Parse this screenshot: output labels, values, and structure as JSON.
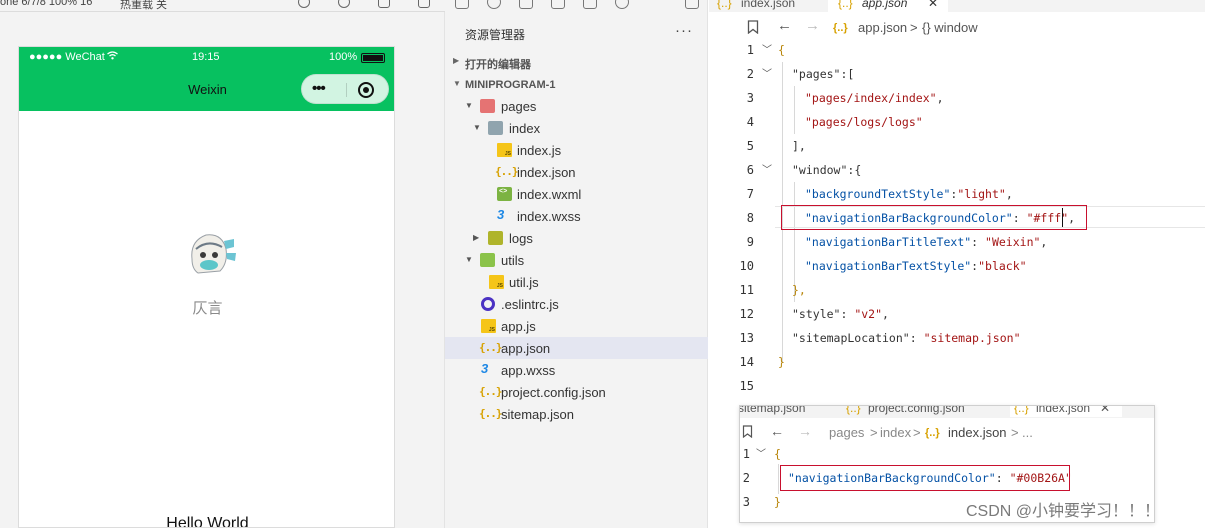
{
  "simulator": {
    "toolbar": {
      "device_text": "one 6/7/8 100% 16",
      "mode_text": "热重载 关"
    },
    "status_bar": {
      "signal": "●●●●● WeChat",
      "time": "19:15",
      "battery": "100%"
    },
    "nav_bar": {
      "title": "Weixin",
      "capsule_dots": "•••"
    },
    "user": {
      "nickname": "仄言"
    },
    "motto": "Hello World",
    "colors": {
      "nav_bg": "#07c160"
    }
  },
  "explorer": {
    "title": "资源管理器",
    "more": "···",
    "open_editors": "打开的编辑器",
    "project": "MINIPROGRAM-1",
    "files": [
      {
        "name": "pages",
        "icon": "folder-red"
      },
      {
        "name": "index",
        "icon": "folder-gray"
      },
      {
        "name": "index.js",
        "icon": "js"
      },
      {
        "name": "index.json",
        "icon": "json"
      },
      {
        "name": "index.wxml",
        "icon": "wxml"
      },
      {
        "name": "index.wxss",
        "icon": "wxss"
      },
      {
        "name": "logs",
        "icon": "folder-lime"
      },
      {
        "name": "utils",
        "icon": "folder-green"
      },
      {
        "name": "util.js",
        "icon": "js"
      },
      {
        "name": ".eslintrc.js",
        "icon": "eslint"
      },
      {
        "name": "app.js",
        "icon": "js"
      },
      {
        "name": "app.json",
        "icon": "json",
        "selected": true
      },
      {
        "name": "app.wxss",
        "icon": "wxss"
      },
      {
        "name": "project.config.json",
        "icon": "json"
      },
      {
        "name": "sitemap.json",
        "icon": "json"
      }
    ]
  },
  "editor": {
    "tabs": [
      {
        "label": "index.json"
      },
      {
        "label": "app.json",
        "active": true
      }
    ],
    "breadcrumb": {
      "file": "app.json",
      "sep": ">",
      "symbol": "{} window"
    },
    "line_numbers": [
      "1",
      "2",
      "3",
      "4",
      "5",
      "6",
      "7",
      "8",
      "9",
      "10",
      "11",
      "12",
      "13",
      "14",
      "15"
    ],
    "code": {
      "l1": "{",
      "l2_key": "\"pages\"",
      "l2_rest": ":[",
      "l3": "\"pages/index/index\"",
      "l3_rest": ",",
      "l4": "\"pages/logs/logs\"",
      "l5": "],",
      "l6_key": "\"window\"",
      "l6_rest": ":{",
      "l7_key": "\"backgroundTextStyle\"",
      "l7_mid": ":",
      "l7_val": "\"light\"",
      "l7_end": ",",
      "l8_key": "\"navigationBarBackgroundColor\"",
      "l8_mid": ": ",
      "l8_val": "\"#fff\"",
      "l8_end": ",",
      "l9_key": "\"navigationBarTitleText\"",
      "l9_mid": ": ",
      "l9_val": "\"Weixin\"",
      "l9_end": ",",
      "l10_key": "\"navigationBarTextStyle\"",
      "l10_mid": ":",
      "l10_val": "\"black\"",
      "l11": "},",
      "l12_key": "\"style\"",
      "l12_mid": ": ",
      "l12_val": "\"v2\"",
      "l12_end": ",",
      "l13_key": "\"sitemapLocation\"",
      "l13_mid": ": ",
      "l13_val": "\"sitemap.json\"",
      "l14": "}"
    }
  },
  "overlay": {
    "tabs": [
      {
        "label": "sitemap.json"
      },
      {
        "label": "project.config.json"
      },
      {
        "label": "index.json",
        "active": true
      }
    ],
    "breadcrumb": {
      "a": "pages",
      "b": "index",
      "c": "index.json",
      "d": "..."
    },
    "line_numbers": [
      "1",
      "2",
      "3"
    ],
    "code": {
      "l1": "{",
      "l2_key": "\"navigationBarBackgroundColor\"",
      "l2_mid": ": ",
      "l2_val": "\"#00B26A\"",
      "l3": "}"
    }
  },
  "watermark": "CSDN @小钟要学习！！！"
}
